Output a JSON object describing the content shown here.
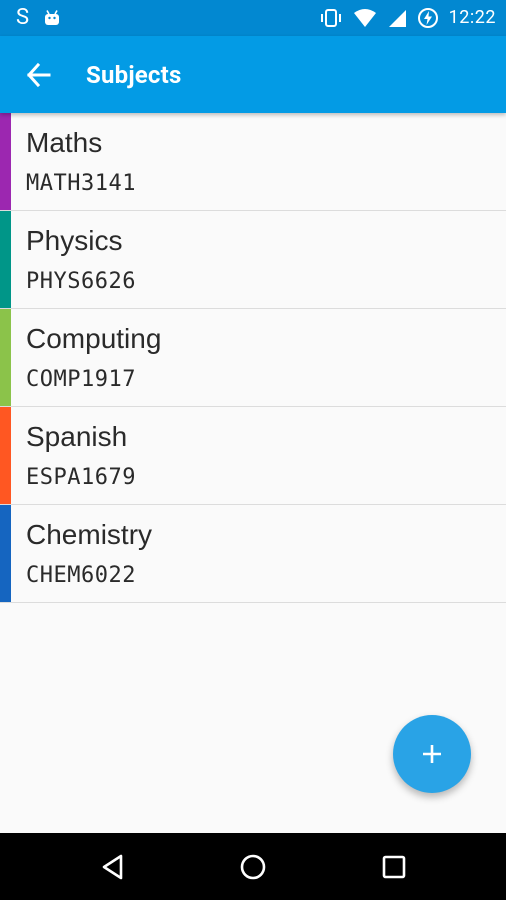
{
  "status_bar": {
    "left_glyph": "S",
    "time": "12:22",
    "icons": [
      "android-notification-icon",
      "vibrate-icon",
      "wifi-icon",
      "signal-icon",
      "battery-charging-icon"
    ]
  },
  "app_bar": {
    "title": "Subjects",
    "back_icon": "arrow-back-icon"
  },
  "subjects": [
    {
      "name": "Maths",
      "code": "MATH3141",
      "color": "#9c27b0"
    },
    {
      "name": "Physics",
      "code": "PHYS6626",
      "color": "#009688"
    },
    {
      "name": "Computing",
      "code": "COMP1917",
      "color": "#8bc34a"
    },
    {
      "name": "Spanish",
      "code": "ESPA1679",
      "color": "#ff5722"
    },
    {
      "name": "Chemistry",
      "code": "CHEM6022",
      "color": "#1565c0"
    }
  ],
  "fab": {
    "icon": "plus-icon",
    "color": "#29a3e6"
  },
  "nav_bar": {
    "icons": [
      "back-triangle-icon",
      "home-circle-icon",
      "recents-square-icon"
    ]
  },
  "colors": {
    "status_bar": "#0288d1",
    "app_bar": "#039be5",
    "background": "#fafafa",
    "divider": "#dcdcdc"
  }
}
